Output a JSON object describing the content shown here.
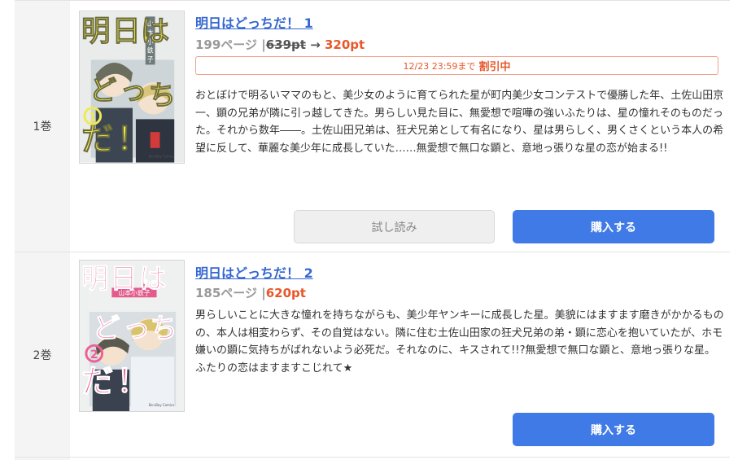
{
  "volumes": [
    {
      "label": "1巻",
      "title": "明日はどっちだ！ 1",
      "pages": "199ページ",
      "separator": "|",
      "old_price": "639pt",
      "arrow": "→",
      "price": "320pt",
      "sale_date": "12/23 23:59まで",
      "sale_label": "割引中",
      "description": "おとぼけで明るいママのもと、美少女のように育てられた星が町内美少女コンテストで優勝した年、土佐山田京一、顕の兄弟が隣に引っ越してきた。男らしい見た目に、無愛想で喧嘩の強いふたりは、星の憧れそのものだった。それから数年――。土佐山田兄弟は、狂犬兄弟として有名になり、星は男らしく、男くさくという本人の希望に反して、華麗な美少年に成長していた……無愛想で無口な顕と、意地っ張りな星の恋が始まる!!",
      "trial_button": "試し読み",
      "buy_button": "購入する",
      "cover": {
        "title_glyphs": [
          "明",
          "日",
          "は",
          "ど",
          "っ",
          "ち",
          "だ",
          "！"
        ],
        "number": "1",
        "author": "山本小鉄子",
        "romaji": "ASHITA WA DOCCHIDA!",
        "credit": "Presented by Kotetsuko Yamamoto",
        "publisher": "Be×Boy Comics",
        "title_color": "#f0ea52",
        "bg_color": "#e9ecea"
      }
    },
    {
      "label": "2巻",
      "title": "明日はどっちだ！ 2",
      "pages": "185ページ",
      "separator": "|",
      "price": "620pt",
      "description": "男らしいことに大きな憧れを持ちながらも、美少年ヤンキーに成長した星。美貌にはますます磨きがかかるものの、本人は相変わらず、その自覚はない。隣に住む土佐山田家の狂犬兄弟の弟・顕に恋心を抱いていたが、ホモ嫌いの顕に気持ちがばれないよう必死だ。それなのに、キスされて!!?無愛想で無口な顕と、意地っ張りな星。ふたりの恋はますますこじれて★",
      "buy_button": "購入する",
      "cover": {
        "title_glyphs": [
          "明",
          "日",
          "は",
          "ど",
          "っ",
          "ち",
          "だ",
          "！"
        ],
        "number": "2",
        "author": "山本小鉄子",
        "romaji": "ASHITA WA DOCCHIDA!",
        "credit": "Presented by Kotetsuko Yamamoto",
        "publisher": "Be×Boy Comics",
        "title_color": "#ef5f93",
        "bg_color": "#eef1f0"
      }
    }
  ],
  "colors": {
    "link": "#3467d1",
    "price": "#e8572a",
    "buy_button": "#3f7ae6",
    "volume_column": "#f4f4f4"
  }
}
